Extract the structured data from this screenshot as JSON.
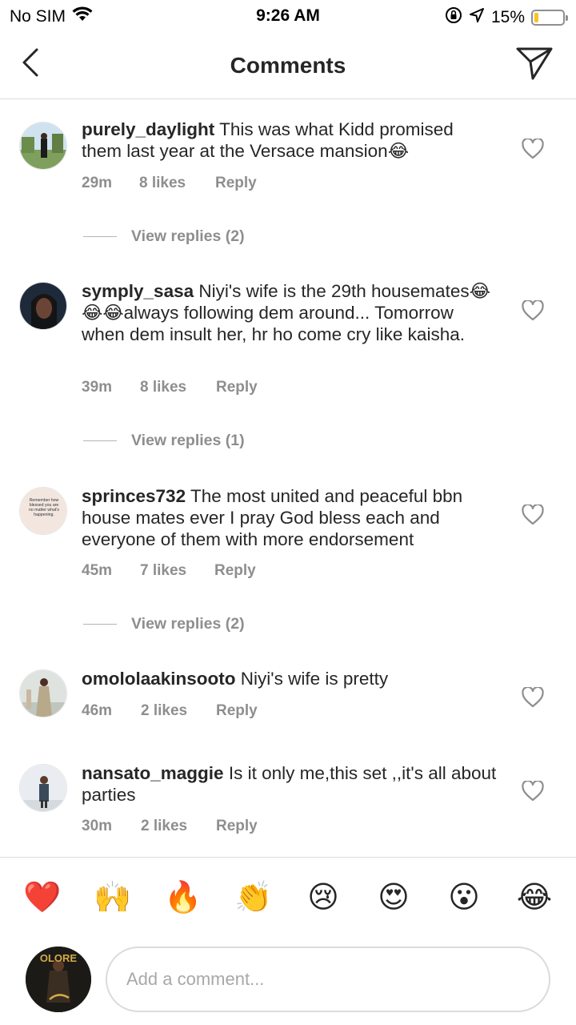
{
  "status_bar": {
    "carrier": "No SIM",
    "time": "9:26 AM",
    "battery_percent": "15%",
    "battery_level": 0.15,
    "icons": [
      "wifi-icon",
      "orientation-lock-icon",
      "location-arrow-icon",
      "battery-icon"
    ]
  },
  "header": {
    "title": "Comments",
    "back_icon": "chevron-left-icon",
    "send_icon": "paper-plane-icon"
  },
  "comments": [
    {
      "username": "purely_daylight",
      "text": "This was what Kidd promised them last year at the Versace mansion😂",
      "time": "29m",
      "likes": "8 likes",
      "reply": "Reply",
      "view_replies": "View replies (2)"
    },
    {
      "username": "symply_sasa",
      "text": "Niyi's wife is the 29th housemates😂😂😂always following dem around... Tomorrow when dem insult her, hr ho come cry like kaisha.",
      "time": "39m",
      "likes": "8 likes",
      "reply": "Reply",
      "view_replies": "View replies (1)"
    },
    {
      "username": "sprinces732",
      "text": "The most united and peaceful bbn house mates ever I pray God bless each and everyone of them with more endorsement",
      "time": "45m",
      "likes": "7 likes",
      "reply": "Reply",
      "view_replies": "View replies (2)",
      "avatar_text": "Remember how blessed you are no matter what's happening."
    },
    {
      "username": "omololaakinsooto",
      "text": "Niyi's wife is pretty",
      "time": "46m",
      "likes": "2 likes",
      "reply": "Reply"
    },
    {
      "username": "nansato_maggie",
      "text": "Is it only me,this set ,,it's all about parties",
      "time": "30m",
      "likes": "2 likes",
      "reply": "Reply"
    }
  ],
  "reactions": [
    "❤️",
    "🙌",
    "🔥",
    "👏",
    "😢",
    "😍",
    "😮",
    "😂"
  ],
  "compose": {
    "placeholder": "Add a comment...",
    "avatar_text": "OLORE"
  },
  "colors": {
    "text": "#262626",
    "meta": "#8e8e8e",
    "divider": "#dbdbdb",
    "battery": "#f7c325"
  }
}
